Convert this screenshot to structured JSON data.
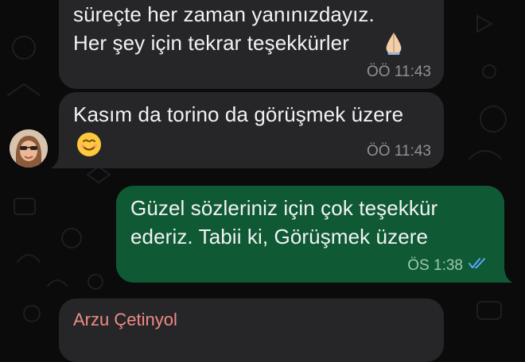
{
  "messages": [
    {
      "lines": [
        "süreçte her zaman yanınızdayız.",
        "Her şey için tekrar teşekkürler"
      ],
      "emoji": "praying-hands",
      "time": "ÖÖ 11:43"
    },
    {
      "lines": [
        "Kasım da torino da görüşmek üzere"
      ],
      "emoji": "smiling-face",
      "time": "ÖÖ 11:43"
    },
    {
      "lines": [
        "Güzel sözleriniz için çok teşekkür",
        "ederiz. Tabii ki, Görüşmek üzere"
      ],
      "time": "ÖS 1:38",
      "status": "read"
    },
    {
      "sender": "Arzu Çetinyol"
    }
  ],
  "colors": {
    "incoming_bubble": "#262628",
    "outgoing_bubble": "#0f5a34",
    "read_ticks": "#5aa7ff",
    "sender_name": "#f08b86"
  }
}
